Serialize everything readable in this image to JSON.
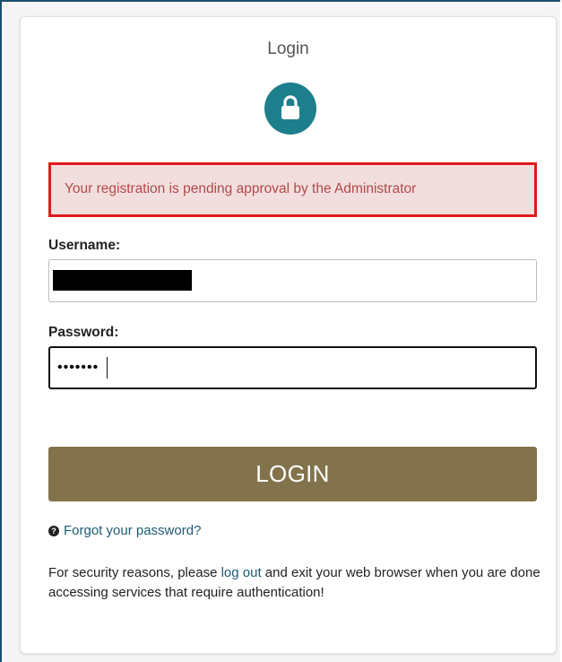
{
  "login_form": {
    "title": "Login",
    "lock_icon": "lock-icon",
    "alert_message": "Your registration is pending approval by the Administrator",
    "username_label": "Username:",
    "username_value": "",
    "password_label": "Password:",
    "password_value": "•••••••",
    "login_button_label": "LOGIN",
    "forgot_link_icon": "question-circle-icon",
    "forgot_link_label": "Forgot your password?",
    "notice_before": "For security reasons, please ",
    "notice_link": "log out",
    "notice_after": " and exit your web browser when you are done accessing services that require authentication!"
  },
  "colors": {
    "frame_border": "#1d4f6e",
    "lock_circle": "#1e7f8c",
    "alert_bg": "#f3dede",
    "alert_border": "#e01b1b",
    "alert_text": "#b14a48",
    "login_button": "#82734c",
    "link": "#1e5a73"
  }
}
